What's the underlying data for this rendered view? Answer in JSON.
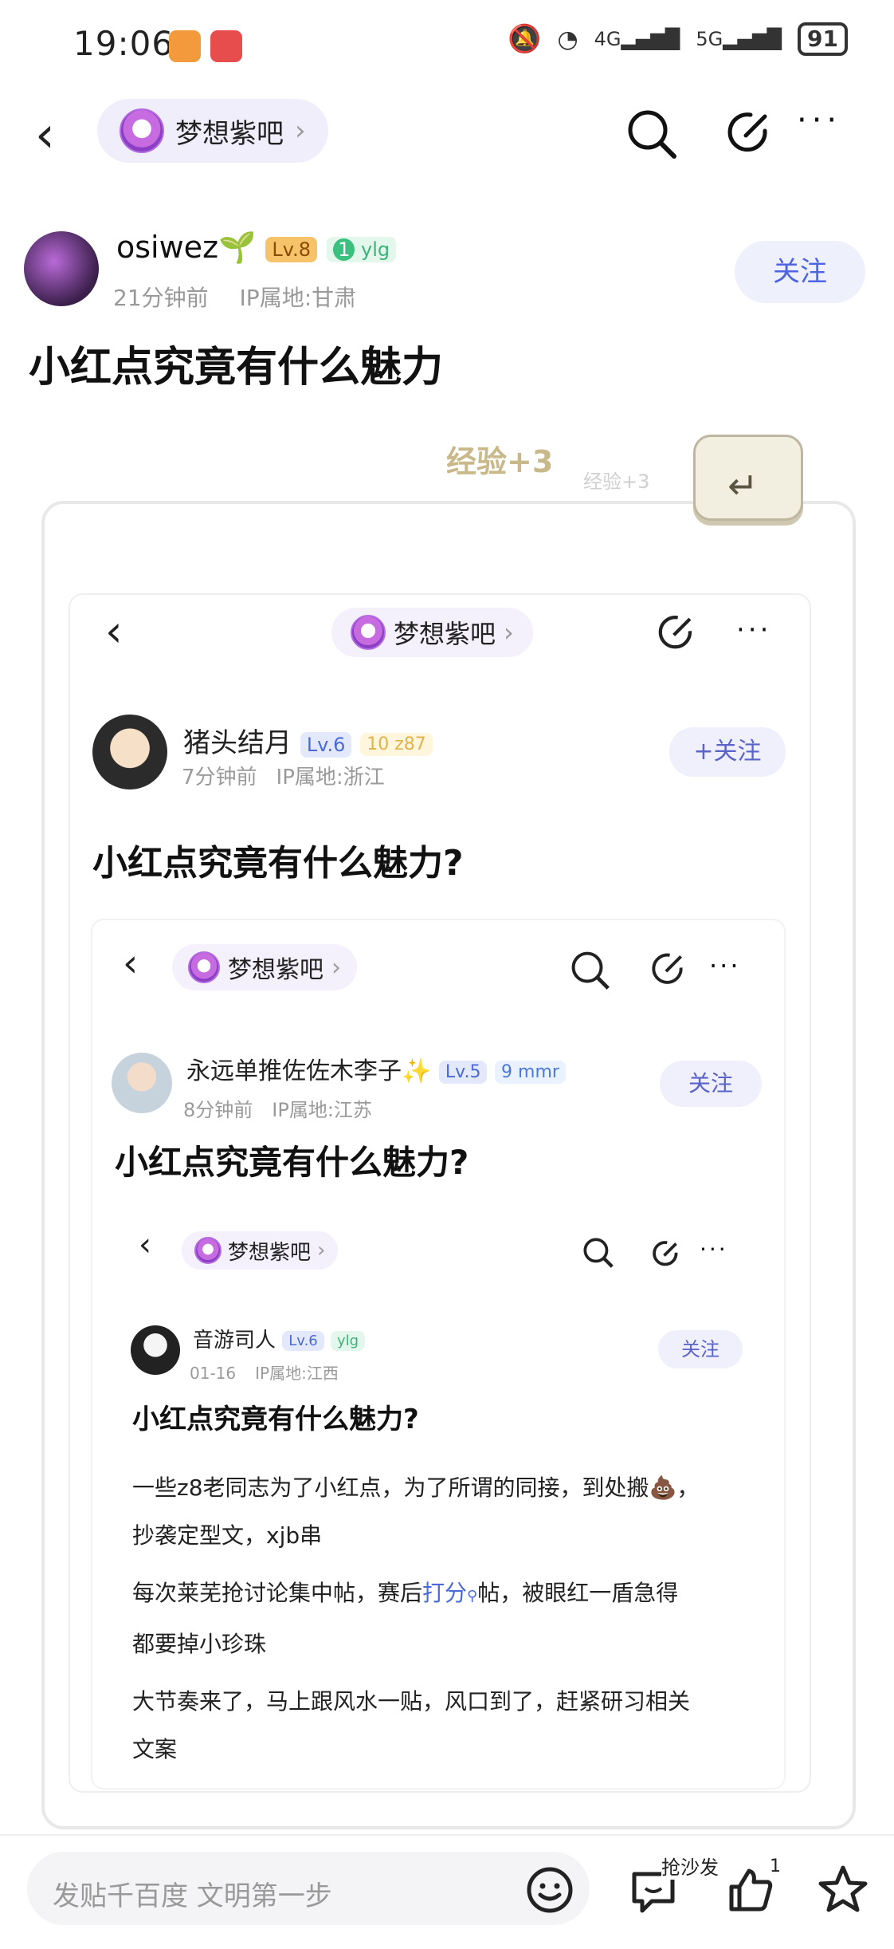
{
  "status_bar": {
    "time": "19:06",
    "battery": "91",
    "signal_4g": "4G",
    "signal_5g": "5G"
  },
  "nav": {
    "forum_name": "梦想紫吧",
    "chevron": "›"
  },
  "post": {
    "author": "osiwez🌱",
    "level": "Lv.8",
    "fan_num": "1",
    "fan_tag": "ylg",
    "time_ago": "21分钟前",
    "ip": "IP属地:甘肃",
    "follow_label": "关注",
    "title": "小红点究竟有什么魅力"
  },
  "exp": {
    "big": "经验+3",
    "small": "经验+3"
  },
  "image_l1": {
    "forum_name": "梦想紫吧",
    "author": "猪头结月",
    "level": "Lv.6",
    "fan_num": "10",
    "fan_tag": "z87",
    "time_ago": "7分钟前",
    "ip": "IP属地:浙江",
    "follow_label": "+关注",
    "title": "小红点究竟有什么魅力?"
  },
  "image_l2": {
    "forum_name": "梦想紫吧",
    "author": "永远单推佐佐木李子✨",
    "level": "Lv.5",
    "fan_num": "9",
    "fan_tag": "mmr",
    "time_ago": "8分钟前",
    "ip": "IP属地:江苏",
    "follow_label": "关注",
    "title": "小红点究竟有什么魅力?"
  },
  "image_l3": {
    "forum_name": "梦想紫吧",
    "author": "音游司人",
    "level": "Lv.6",
    "fan_tag": "ylg",
    "date": "01-16",
    "ip": "IP属地:江西",
    "follow_label": "关注",
    "title": "小红点究竟有什么魅力?",
    "para1": "一些z8老同志为了小红点，为了所谓的同接，到处搬💩，",
    "para1b": "抄袭定型文，xjb串",
    "para2a": "每次莱芜抢讨论集中帖，赛后",
    "para2link": "打分",
    "para2b": "帖，被眼红一盾急得",
    "para2c": "都要掉小珍珠",
    "para3": "大节奏来了，马上跟风水一贴，风口到了，赶紧研习相关",
    "para3b": "文案"
  },
  "bottom": {
    "input_placeholder": "发贴千百度 文明第一步",
    "sofa_label": "抢沙发",
    "like_count": "1"
  }
}
